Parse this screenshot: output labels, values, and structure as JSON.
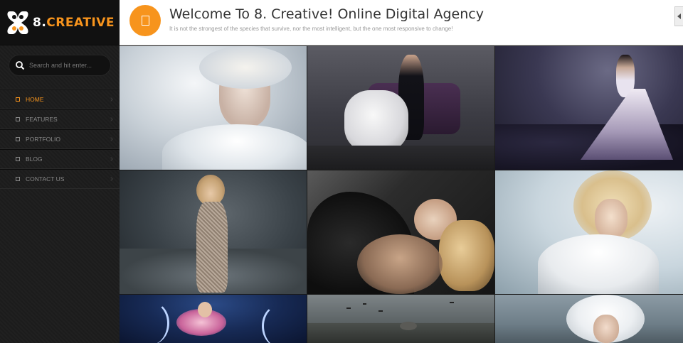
{
  "brand": {
    "number": "8.",
    "word": "CREATIVE",
    "accent": "#f7941d"
  },
  "search": {
    "placeholder": "Search and hit enter..."
  },
  "nav": {
    "items": [
      {
        "label": "HOME",
        "active": true
      },
      {
        "label": "FEATURES",
        "active": false
      },
      {
        "label": "PORTFOLIO",
        "active": false
      },
      {
        "label": "BLOG",
        "active": false
      },
      {
        "label": "CONTACT US",
        "active": false
      }
    ]
  },
  "header": {
    "title": "Welcome To 8. Creative! Online Digital Agency",
    "subtitle": "It is not the strongest of the species that survive, nor the most intelligent, but the one most responsive to change!",
    "icon": "document-icon"
  },
  "gallery": {
    "tiles": [
      {
        "name": "portrait-fur-white"
      },
      {
        "name": "couple-angel-sofa"
      },
      {
        "name": "woman-purple-dress-clouds"
      },
      {
        "name": "woman-sequin-dress-storm"
      },
      {
        "name": "woman-black-fur"
      },
      {
        "name": "woman-white-lace"
      },
      {
        "name": "dancer-night-sky"
      },
      {
        "name": "field-birds"
      },
      {
        "name": "woman-white-curls"
      }
    ]
  }
}
